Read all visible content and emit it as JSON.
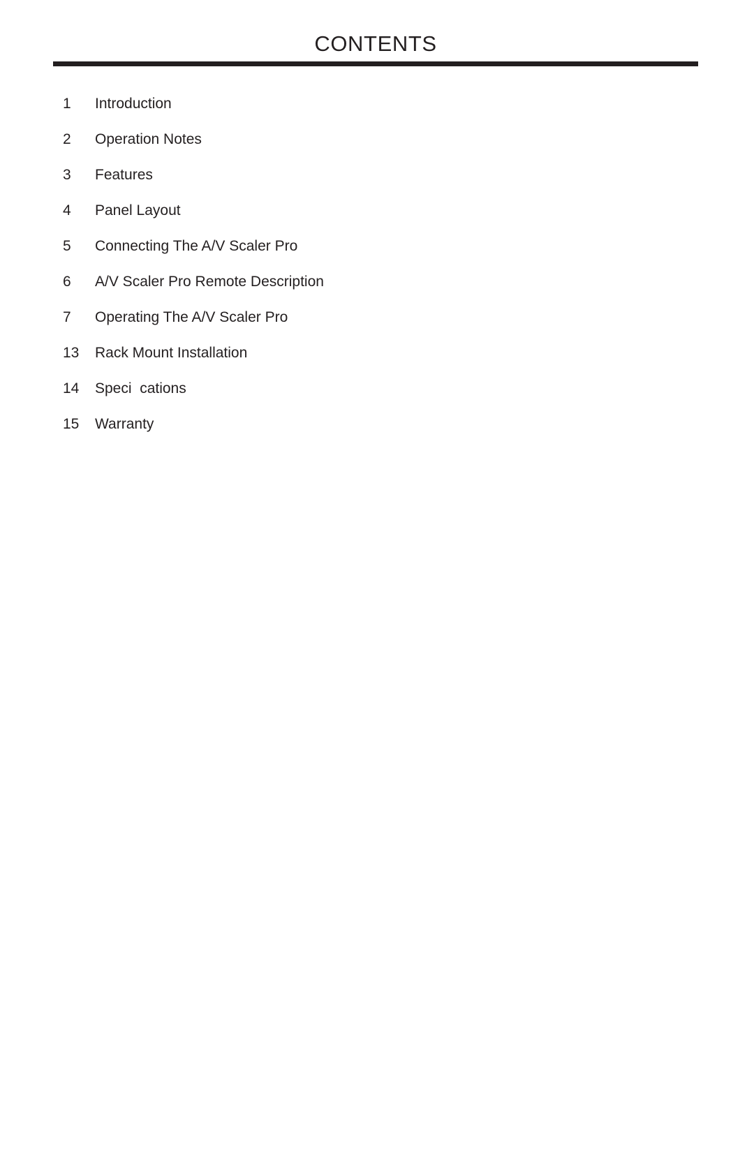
{
  "document": {
    "title": "CONTENTS",
    "text_color": "#231f20",
    "background_color": "#ffffff",
    "rule_color": "#231f20"
  },
  "contents": {
    "heading": "CONTENTS",
    "entries": [
      {
        "page": "1",
        "label": "Introduction"
      },
      {
        "page": "2",
        "label": "Operation Notes"
      },
      {
        "page": "3",
        "label": "Features"
      },
      {
        "page": "4",
        "label": "Panel Layout"
      },
      {
        "page": "5",
        "label": "Connecting The A/V Scaler Pro"
      },
      {
        "page": "6",
        "label": "A/V Scaler Pro Remote Description"
      },
      {
        "page": "7",
        "label": "Operating The A/V Scaler Pro"
      },
      {
        "page": "13",
        "label": "Rack Mount Installation"
      },
      {
        "page": "14",
        "label": "Speci  cations"
      },
      {
        "page": "15",
        "label": "Warranty"
      }
    ]
  }
}
